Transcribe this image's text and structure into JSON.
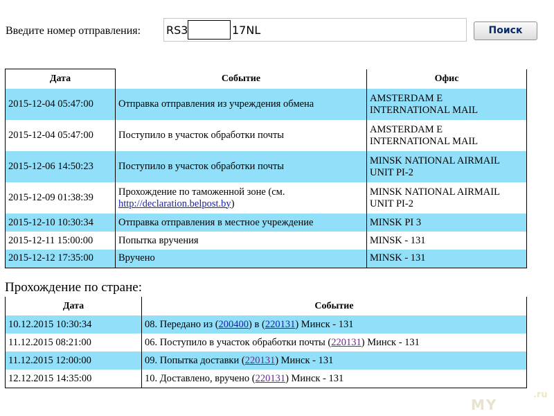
{
  "search": {
    "label": "Введите номер отправления:",
    "value_prefix": "RS3",
    "value_suffix": "17NL",
    "button_label": "Поиск"
  },
  "tracking": {
    "headers": [
      "Дата",
      "Событие",
      "Офис"
    ],
    "rows": [
      {
        "date": "2015-12-04 05:47:00",
        "event": "Отправка отправления из учреждения обмена",
        "office_1": "AMSTERDAM E",
        "office_2": "INTERNATIONAL MAIL"
      },
      {
        "date": "2015-12-04 05:47:00",
        "event": "Поступило в участок обработки почты",
        "office_1": "AMSTERDAM E",
        "office_2": "INTERNATIONAL MAIL"
      },
      {
        "date": "2015-12-06 14:50:23",
        "event": "Поступило в участок обработки почты",
        "office_1": "MINSK NATIONAL AIRMAIL",
        "office_2": "UNIT PI-2"
      },
      {
        "date": "2015-12-09 01:38:39",
        "event_1": "Прохождение по таможенной зоне (см.",
        "event_link": "http://declaration.belpost.by",
        "event_2": ")",
        "office_1": "MINSK NATIONAL AIRMAIL",
        "office_2": "UNIT PI-2"
      },
      {
        "date": "2015-12-10 10:30:34",
        "event": "Отправка отправления в местное учреждение",
        "office_1": "MINSK PI 3"
      },
      {
        "date": "2015-12-11 15:00:00",
        "event": "Попытка вручения",
        "office_1": "MINSK - 131"
      },
      {
        "date": "2015-12-12 17:35:00",
        "event": "Вручено",
        "office_1": "MINSK - 131"
      }
    ]
  },
  "country": {
    "title": "Прохождение по стране:",
    "headers": [
      "Дата",
      "Событие"
    ],
    "rows": [
      {
        "date": "10.12.2015 10:30:34",
        "pre": "08. Передано из (",
        "link1": "200400",
        "mid": ") в (",
        "link2": "220131",
        "post": ") Минск - 131"
      },
      {
        "date": "11.12.2015 08:21:00",
        "pre": "06. Поступило в участок обработки почты (",
        "link1": "220131",
        "post": ") Минск - 131"
      },
      {
        "date": "11.12.2015 12:00:00",
        "pre": "09. Попытка доставки (",
        "link1": "220131",
        "post": ") Минск - 131"
      },
      {
        "date": "12.12.2015 14:35:00",
        "pre": "10. Доставлено, вручено (",
        "link1": "220131",
        "post": ") Минск - 131"
      }
    ]
  },
  "watermark": {
    "text": "MY",
    "suffix": ".ru"
  },
  "colors": {
    "row_highlight": "#91dff8",
    "link": "#1a22a8",
    "link_visited": "#6a2a8a"
  }
}
